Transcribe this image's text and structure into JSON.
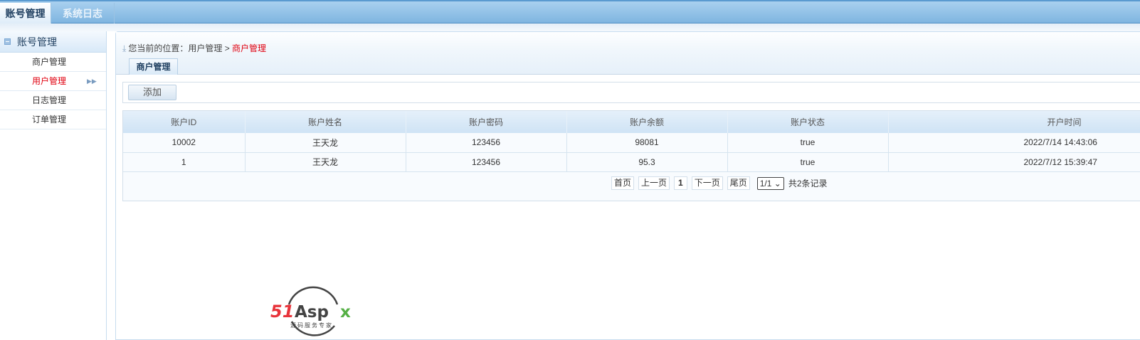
{
  "top_tabs": [
    {
      "label": "账号管理"
    },
    {
      "label": "系统日志"
    }
  ],
  "sidebar": {
    "title": "账号管理",
    "items": [
      {
        "label": "商户管理"
      },
      {
        "label": "用户管理"
      },
      {
        "label": "日志管理"
      },
      {
        "label": "订单管理"
      }
    ]
  },
  "breadcrumb": {
    "prefix": "您当前的位置：",
    "parent": "用户管理",
    "separator": ">",
    "current": "商户管理"
  },
  "subtab": "商户管理",
  "toolbar": {
    "add_label": "添加"
  },
  "table": {
    "headers": [
      "账户ID",
      "账户姓名",
      "账户密码",
      "账户余额",
      "账户状态",
      "开户时间"
    ],
    "rows": [
      [
        "10002",
        "王天龙",
        "123456",
        "98081",
        "true",
        "2022/7/14 14:43:06"
      ],
      [
        "1",
        "王天龙",
        "123456",
        "95.3",
        "true",
        "2022/7/12 15:39:47"
      ]
    ]
  },
  "pager": {
    "first": "首页",
    "prev": "上一页",
    "page": "1",
    "next": "下一页",
    "last": "尾页",
    "select": "1/1",
    "summary": "共2条记录"
  },
  "logo": {
    "brand": "51Aspx",
    "tagline": "源码服务专家"
  }
}
